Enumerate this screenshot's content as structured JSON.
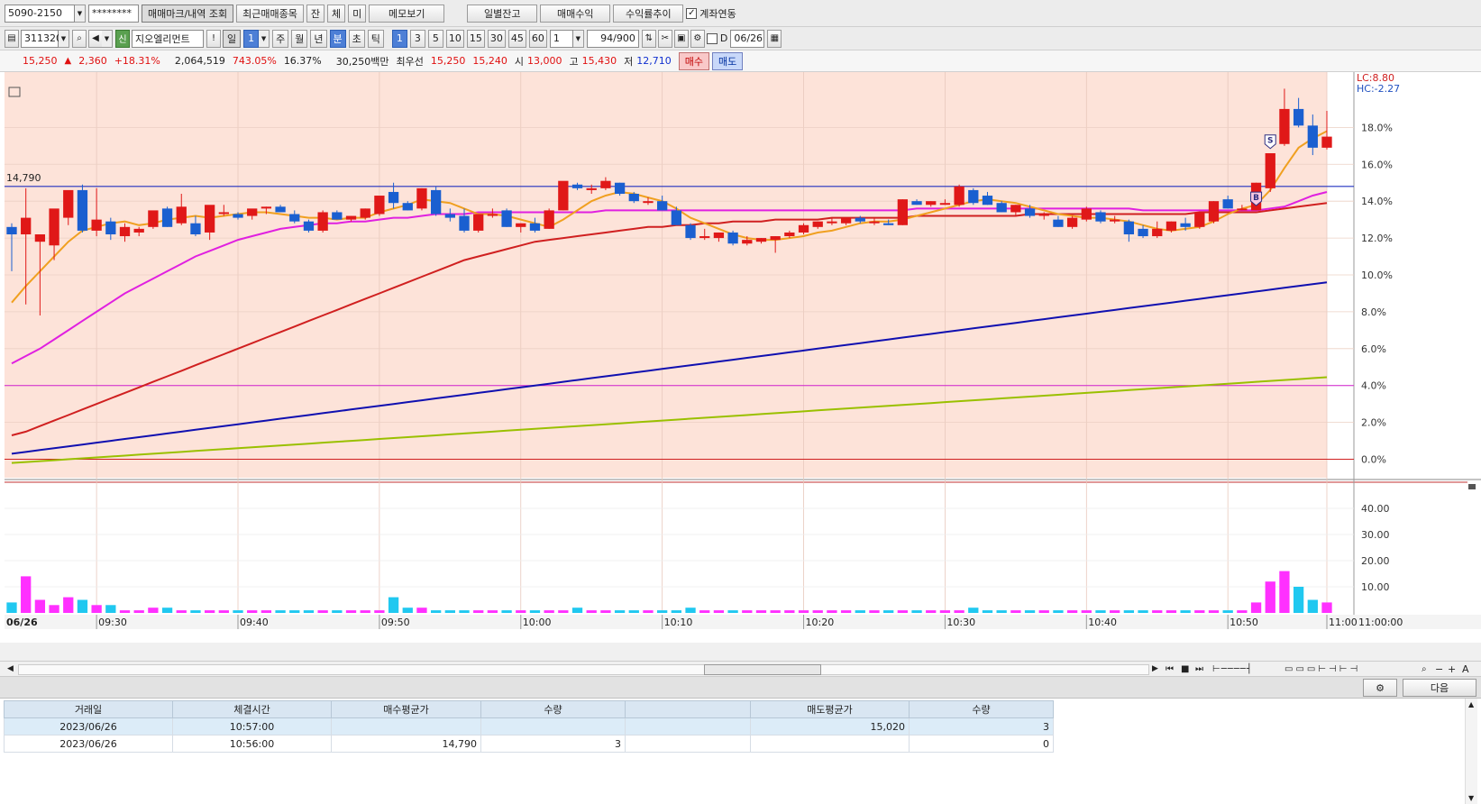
{
  "toolbar1": {
    "account": "5090-2150",
    "password": "********",
    "buttons": [
      "매매마크/내역 조회",
      "최근매매종목",
      "잔",
      "체",
      "미",
      "메모보기",
      "일별잔고",
      "매매수익",
      "수익률추이"
    ],
    "link_label": "계좌연동"
  },
  "toolbar2": {
    "code": "311320",
    "badge": "신",
    "name": "지오엘리먼트",
    "alert": "!",
    "periods": [
      "일",
      "1",
      "주",
      "월",
      "년",
      "분",
      "초",
      "틱"
    ],
    "intervals": [
      "1",
      "3",
      "5",
      "10",
      "15",
      "30",
      "45",
      "60"
    ],
    "unit_value": "1",
    "count": "94/900",
    "d_label": "D",
    "date": "06/26"
  },
  "infobar": {
    "price": "15,250",
    "change": "2,360",
    "change_pct": "+18.31%",
    "volume": "2,064,519",
    "vol_ratio": "743.05%",
    "turnover": "16.37%",
    "amount": "30,250백만",
    "quote_label": "최우선",
    "ask": "15,250",
    "bid": "15,240",
    "open_label": "시",
    "open": "13,000",
    "high_label": "고",
    "high": "15,430",
    "low_label": "저",
    "low": "12,710",
    "buy_label": "매수",
    "sell_label": "매도"
  },
  "chart": {
    "ref_line_label": "14,790",
    "lc_label": "LC:8.80",
    "hc_label": "HC:-2.27",
    "date_label": "06/26",
    "price_ticks": [
      "18.0%",
      "16.0%",
      "14.0%",
      "12.0%",
      "10.0%",
      "8.0%",
      "6.0%",
      "4.0%",
      "2.0%",
      "0.0%"
    ],
    "volume_ticks": [
      "40.00",
      "30.00",
      "20.00",
      "10.00"
    ],
    "time_ticks": [
      "09:30",
      "09:40",
      "09:50",
      "10:00",
      "10:10",
      "10:20",
      "10:30",
      "10:40",
      "10:50",
      "11:00",
      "11:00:00"
    ],
    "marker_sell": "S",
    "marker_buy": "B",
    "colors": {
      "up": "#e01818",
      "down": "#1a5fd0",
      "ma5": "#f0a020",
      "ma20": "#e020e0",
      "ma60": "#d02020",
      "ma120": "#1010b0",
      "ma240": "#9ac000"
    }
  },
  "chart_data": {
    "type": "candlestick",
    "candles": [
      {
        "o": 12.6,
        "h": 12.8,
        "l": 10.2,
        "c": 12.2
      },
      {
        "o": 12.2,
        "h": 14.7,
        "l": 8.4,
        "c": 13.1
      },
      {
        "o": 11.8,
        "h": 12.1,
        "l": 7.8,
        "c": 12.2
      },
      {
        "o": 11.6,
        "h": 12.8,
        "l": 10.8,
        "c": 13.6
      },
      {
        "o": 13.1,
        "h": 14.3,
        "l": 12.7,
        "c": 14.6
      },
      {
        "o": 14.6,
        "h": 14.9,
        "l": 12.3,
        "c": 12.4
      },
      {
        "o": 12.4,
        "h": 14.7,
        "l": 12.1,
        "c": 13.0
      },
      {
        "o": 12.9,
        "h": 13.1,
        "l": 11.9,
        "c": 12.2
      },
      {
        "o": 12.1,
        "h": 12.8,
        "l": 11.8,
        "c": 12.6
      },
      {
        "o": 12.3,
        "h": 12.6,
        "l": 12.1,
        "c": 12.5
      },
      {
        "o": 12.6,
        "h": 13.3,
        "l": 12.5,
        "c": 13.5
      },
      {
        "o": 13.6,
        "h": 13.7,
        "l": 12.6,
        "c": 12.6
      },
      {
        "o": 12.8,
        "h": 14.4,
        "l": 12.7,
        "c": 13.7
      },
      {
        "o": 12.8,
        "h": 13.2,
        "l": 12.1,
        "c": 12.2
      },
      {
        "o": 12.3,
        "h": 12.5,
        "l": 11.9,
        "c": 13.8
      },
      {
        "o": 13.4,
        "h": 13.8,
        "l": 13.2,
        "c": 13.4
      },
      {
        "o": 13.3,
        "h": 13.4,
        "l": 13.0,
        "c": 13.1
      },
      {
        "o": 13.2,
        "h": 13.4,
        "l": 13.0,
        "c": 13.6
      },
      {
        "o": 13.6,
        "h": 13.7,
        "l": 13.3,
        "c": 13.7
      },
      {
        "o": 13.7,
        "h": 13.8,
        "l": 13.4,
        "c": 13.4
      },
      {
        "o": 13.3,
        "h": 13.5,
        "l": 12.8,
        "c": 12.9
      },
      {
        "o": 12.9,
        "h": 13.0,
        "l": 12.3,
        "c": 12.4
      },
      {
        "o": 12.4,
        "h": 13.5,
        "l": 12.3,
        "c": 13.4
      },
      {
        "o": 13.4,
        "h": 13.5,
        "l": 13.0,
        "c": 13.0
      },
      {
        "o": 13.0,
        "h": 13.2,
        "l": 12.9,
        "c": 13.2
      },
      {
        "o": 13.1,
        "h": 13.6,
        "l": 13.0,
        "c": 13.6
      },
      {
        "o": 13.3,
        "h": 13.9,
        "l": 13.2,
        "c": 14.3
      },
      {
        "o": 14.5,
        "h": 15.0,
        "l": 13.6,
        "c": 13.9
      },
      {
        "o": 13.9,
        "h": 14.0,
        "l": 13.5,
        "c": 13.5
      },
      {
        "o": 13.6,
        "h": 14.7,
        "l": 13.5,
        "c": 14.7
      },
      {
        "o": 14.6,
        "h": 14.8,
        "l": 13.2,
        "c": 13.3
      },
      {
        "o": 13.3,
        "h": 13.6,
        "l": 12.9,
        "c": 13.1
      },
      {
        "o": 13.2,
        "h": 13.6,
        "l": 12.3,
        "c": 12.4
      },
      {
        "o": 12.4,
        "h": 13.2,
        "l": 12.3,
        "c": 13.3
      },
      {
        "o": 13.3,
        "h": 13.6,
        "l": 13.1,
        "c": 13.3
      },
      {
        "o": 13.5,
        "h": 13.6,
        "l": 12.6,
        "c": 12.6
      },
      {
        "o": 12.6,
        "h": 12.8,
        "l": 12.3,
        "c": 12.8
      },
      {
        "o": 12.8,
        "h": 13.1,
        "l": 12.3,
        "c": 12.4
      },
      {
        "o": 12.5,
        "h": 13.6,
        "l": 12.5,
        "c": 13.5
      },
      {
        "o": 13.5,
        "h": 14.6,
        "l": 13.5,
        "c": 15.1
      },
      {
        "o": 14.9,
        "h": 15.0,
        "l": 14.6,
        "c": 14.7
      },
      {
        "o": 14.6,
        "h": 14.9,
        "l": 14.4,
        "c": 14.7
      },
      {
        "o": 14.7,
        "h": 15.3,
        "l": 14.6,
        "c": 15.1
      },
      {
        "o": 15.0,
        "h": 15.0,
        "l": 14.3,
        "c": 14.4
      },
      {
        "o": 14.4,
        "h": 14.5,
        "l": 13.9,
        "c": 14.0
      },
      {
        "o": 14.0,
        "h": 14.2,
        "l": 13.8,
        "c": 14.0
      },
      {
        "o": 14.0,
        "h": 14.3,
        "l": 13.5,
        "c": 13.5
      },
      {
        "o": 13.5,
        "h": 13.7,
        "l": 12.7,
        "c": 12.7
      },
      {
        "o": 12.7,
        "h": 12.8,
        "l": 11.9,
        "c": 12.0
      },
      {
        "o": 12.0,
        "h": 12.5,
        "l": 11.9,
        "c": 12.1
      },
      {
        "o": 12.0,
        "h": 12.3,
        "l": 11.8,
        "c": 12.3
      },
      {
        "o": 12.3,
        "h": 12.4,
        "l": 11.6,
        "c": 11.7
      },
      {
        "o": 11.7,
        "h": 12.1,
        "l": 11.6,
        "c": 11.9
      },
      {
        "o": 11.8,
        "h": 12.0,
        "l": 11.7,
        "c": 12.0
      },
      {
        "o": 11.9,
        "h": 12.1,
        "l": 11.2,
        "c": 12.1
      },
      {
        "o": 12.1,
        "h": 12.4,
        "l": 12.0,
        "c": 12.3
      },
      {
        "o": 12.3,
        "h": 12.8,
        "l": 12.2,
        "c": 12.7
      },
      {
        "o": 12.6,
        "h": 12.9,
        "l": 12.5,
        "c": 12.9
      },
      {
        "o": 12.9,
        "h": 13.1,
        "l": 12.7,
        "c": 12.9
      },
      {
        "o": 12.8,
        "h": 13.1,
        "l": 12.7,
        "c": 13.1
      },
      {
        "o": 13.1,
        "h": 13.2,
        "l": 12.8,
        "c": 12.9
      },
      {
        "o": 12.9,
        "h": 13.1,
        "l": 12.7,
        "c": 12.9
      },
      {
        "o": 12.8,
        "h": 13.0,
        "l": 12.7,
        "c": 12.7
      },
      {
        "o": 12.7,
        "h": 14.1,
        "l": 12.7,
        "c": 14.1
      },
      {
        "o": 14.0,
        "h": 14.1,
        "l": 13.8,
        "c": 13.8
      },
      {
        "o": 13.8,
        "h": 14.0,
        "l": 13.7,
        "c": 14.0
      },
      {
        "o": 13.9,
        "h": 14.1,
        "l": 13.8,
        "c": 13.9
      },
      {
        "o": 13.8,
        "h": 14.9,
        "l": 13.7,
        "c": 14.8
      },
      {
        "o": 14.6,
        "h": 14.7,
        "l": 13.8,
        "c": 13.9
      },
      {
        "o": 14.3,
        "h": 14.5,
        "l": 13.8,
        "c": 13.8
      },
      {
        "o": 13.9,
        "h": 14.0,
        "l": 13.4,
        "c": 13.4
      },
      {
        "o": 13.4,
        "h": 13.8,
        "l": 13.2,
        "c": 13.8
      },
      {
        "o": 13.6,
        "h": 13.8,
        "l": 13.1,
        "c": 13.2
      },
      {
        "o": 13.3,
        "h": 13.4,
        "l": 13.0,
        "c": 13.3
      },
      {
        "o": 13.0,
        "h": 13.2,
        "l": 12.6,
        "c": 12.6
      },
      {
        "o": 12.6,
        "h": 13.2,
        "l": 12.5,
        "c": 13.1
      },
      {
        "o": 13.0,
        "h": 13.7,
        "l": 12.9,
        "c": 13.6
      },
      {
        "o": 13.4,
        "h": 13.5,
        "l": 12.8,
        "c": 12.9
      },
      {
        "o": 12.9,
        "h": 13.2,
        "l": 12.8,
        "c": 13.0
      },
      {
        "o": 12.9,
        "h": 13.0,
        "l": 11.8,
        "c": 12.2
      },
      {
        "o": 12.5,
        "h": 12.7,
        "l": 12.0,
        "c": 12.1
      },
      {
        "o": 12.1,
        "h": 12.9,
        "l": 12.0,
        "c": 12.5
      },
      {
        "o": 12.4,
        "h": 12.9,
        "l": 12.3,
        "c": 12.9
      },
      {
        "o": 12.8,
        "h": 13.1,
        "l": 12.4,
        "c": 12.6
      },
      {
        "o": 12.6,
        "h": 13.4,
        "l": 12.5,
        "c": 13.4
      },
      {
        "o": 12.9,
        "h": 14.0,
        "l": 12.8,
        "c": 14.0
      },
      {
        "o": 14.1,
        "h": 14.3,
        "l": 13.6,
        "c": 13.6
      },
      {
        "o": 13.6,
        "h": 13.8,
        "l": 13.5,
        "c": 13.6
      },
      {
        "o": 13.5,
        "h": 15.0,
        "l": 13.5,
        "c": 15.0
      },
      {
        "o": 14.7,
        "h": 16.6,
        "l": 14.5,
        "c": 16.6
      },
      {
        "o": 17.1,
        "h": 20.1,
        "l": 17.0,
        "c": 19.0
      },
      {
        "o": 19.0,
        "h": 19.6,
        "l": 18.0,
        "c": 18.1
      },
      {
        "o": 18.1,
        "h": 18.7,
        "l": 16.5,
        "c": 16.9
      },
      {
        "o": 16.9,
        "h": 18.9,
        "l": 16.8,
        "c": 17.5
      }
    ],
    "volume": [
      4,
      14,
      5,
      3,
      6,
      5,
      3,
      3,
      1,
      1,
      2,
      2,
      1,
      1,
      1,
      1,
      1,
      1,
      1,
      1,
      1,
      1,
      1,
      1,
      1,
      1,
      1,
      6,
      2,
      2,
      1,
      1,
      1,
      1,
      1,
      1,
      1,
      1,
      1,
      1,
      2,
      1,
      1,
      1,
      1,
      1,
      1,
      1,
      2,
      1,
      1,
      1,
      1,
      1,
      1,
      1,
      1,
      1,
      1,
      1,
      1,
      1,
      1,
      1,
      1,
      1,
      1,
      1,
      2,
      1,
      1,
      1,
      1,
      1,
      1,
      1,
      1,
      1,
      1,
      1,
      1,
      1,
      1,
      1,
      1,
      1,
      1,
      1,
      4,
      12,
      16,
      10,
      5,
      4
    ],
    "ma_lines": {
      "ma5": [
        8.5,
        9.4,
        10.2,
        11.0,
        11.8,
        12.4,
        12.6,
        12.8,
        12.9,
        12.7,
        12.8,
        13.0,
        13.1,
        13.2,
        13.1,
        13.2,
        13.3,
        13.4,
        13.4,
        13.3,
        13.2,
        13.1,
        13.1,
        13.0,
        13.1,
        13.1,
        13.4,
        13.6,
        13.8,
        14.1,
        14.0,
        13.9,
        13.6,
        13.3,
        13.3,
        13.2,
        13.0,
        12.8,
        12.6,
        13.0,
        13.5,
        14.0,
        14.3,
        14.5,
        14.4,
        14.2,
        14.0,
        13.6,
        13.1,
        12.8,
        12.5,
        12.2,
        12.0,
        11.9,
        11.9,
        12.0,
        12.1,
        12.3,
        12.4,
        12.6,
        12.8,
        12.9,
        12.9,
        13.0,
        13.2,
        13.4,
        13.6,
        13.8,
        14.0,
        14.1,
        14.0,
        13.9,
        13.7,
        13.5,
        13.3,
        13.2,
        13.1,
        13.1,
        13.0,
        12.9,
        12.7,
        12.5,
        12.4,
        12.5,
        12.6,
        12.9,
        13.3,
        13.6,
        13.8,
        14.6,
        15.8,
        16.9,
        17.4,
        17.8
      ],
      "ma20": [
        5.2,
        5.6,
        6.0,
        6.5,
        7.0,
        7.5,
        8.0,
        8.5,
        9.0,
        9.4,
        9.8,
        10.2,
        10.6,
        11.0,
        11.3,
        11.6,
        11.9,
        12.1,
        12.3,
        12.5,
        12.6,
        12.7,
        12.8,
        12.8,
        12.9,
        12.9,
        13.0,
        13.1,
        13.1,
        13.2,
        13.3,
        13.3,
        13.3,
        13.4,
        13.4,
        13.4,
        13.4,
        13.4,
        13.4,
        13.4,
        13.4,
        13.4,
        13.5,
        13.5,
        13.5,
        13.5,
        13.5,
        13.5,
        13.5,
        13.5,
        13.5,
        13.5,
        13.5,
        13.5,
        13.5,
        13.5,
        13.5,
        13.5,
        13.5,
        13.5,
        13.5,
        13.5,
        13.5,
        13.5,
        13.6,
        13.6,
        13.6,
        13.6,
        13.6,
        13.6,
        13.6,
        13.6,
        13.6,
        13.6,
        13.6,
        13.6,
        13.6,
        13.6,
        13.6,
        13.6,
        13.5,
        13.5,
        13.5,
        13.5,
        13.5,
        13.5,
        13.5,
        13.5,
        13.5,
        13.6,
        13.7,
        14.0,
        14.3,
        14.5
      ],
      "ma60": [
        1.3,
        1.5,
        1.8,
        2.1,
        2.4,
        2.7,
        3.0,
        3.3,
        3.6,
        3.9,
        4.2,
        4.5,
        4.8,
        5.1,
        5.4,
        5.7,
        6.0,
        6.3,
        6.6,
        6.9,
        7.2,
        7.5,
        7.8,
        8.1,
        8.4,
        8.7,
        9.0,
        9.3,
        9.6,
        9.9,
        10.2,
        10.5,
        10.8,
        11.0,
        11.2,
        11.4,
        11.6,
        11.8,
        11.9,
        12.0,
        12.1,
        12.2,
        12.3,
        12.4,
        12.5,
        12.6,
        12.6,
        12.7,
        12.7,
        12.8,
        12.8,
        12.9,
        12.9,
        12.9,
        13.0,
        13.0,
        13.0,
        13.0,
        13.1,
        13.1,
        13.1,
        13.1,
        13.1,
        13.1,
        13.2,
        13.2,
        13.2,
        13.2,
        13.2,
        13.2,
        13.2,
        13.2,
        13.3,
        13.3,
        13.3,
        13.3,
        13.3,
        13.3,
        13.3,
        13.3,
        13.3,
        13.3,
        13.3,
        13.3,
        13.4,
        13.4,
        13.4,
        13.4,
        13.4,
        13.5,
        13.6,
        13.7,
        13.8,
        13.9
      ],
      "ma120": [
        0.3,
        0.4,
        0.5,
        0.6,
        0.7,
        0.8,
        0.9,
        1.0,
        1.1,
        1.2,
        1.3,
        1.4,
        1.5,
        1.6,
        1.7,
        1.8,
        1.9,
        2.0,
        2.1,
        2.2,
        2.3,
        2.4,
        2.5,
        2.6,
        2.7,
        2.8,
        2.9,
        3.0,
        3.1,
        3.2,
        3.3,
        3.4,
        3.5,
        3.6,
        3.7,
        3.8,
        3.9,
        4.0,
        4.1,
        4.2,
        4.3,
        4.4,
        4.5,
        4.6,
        4.7,
        4.8,
        4.9,
        5.0,
        5.1,
        5.2,
        5.3,
        5.4,
        5.5,
        5.6,
        5.7,
        5.8,
        5.9,
        6.0,
        6.1,
        6.2,
        6.3,
        6.4,
        6.5,
        6.6,
        6.7,
        6.8,
        6.9,
        7.0,
        7.1,
        7.2,
        7.3,
        7.4,
        7.5,
        7.6,
        7.7,
        7.8,
        7.9,
        8.0,
        8.1,
        8.2,
        8.3,
        8.4,
        8.5,
        8.6,
        8.7,
        8.8,
        8.9,
        9.0,
        9.1,
        9.2,
        9.3,
        9.4,
        9.5,
        9.6
      ],
      "ma240": [
        -0.2,
        -0.15,
        -0.1,
        -0.05,
        0,
        0.05,
        0.1,
        0.15,
        0.2,
        0.25,
        0.3,
        0.35,
        0.4,
        0.45,
        0.5,
        0.55,
        0.6,
        0.65,
        0.7,
        0.75,
        0.8,
        0.85,
        0.9,
        0.95,
        1.0,
        1.05,
        1.1,
        1.15,
        1.2,
        1.25,
        1.3,
        1.35,
        1.4,
        1.45,
        1.5,
        1.55,
        1.6,
        1.65,
        1.7,
        1.75,
        1.8,
        1.85,
        1.9,
        1.95,
        2.0,
        2.05,
        2.1,
        2.15,
        2.2,
        2.25,
        2.3,
        2.35,
        2.4,
        2.45,
        2.5,
        2.55,
        2.6,
        2.65,
        2.7,
        2.75,
        2.8,
        2.85,
        2.9,
        2.95,
        3.0,
        3.05,
        3.1,
        3.15,
        3.2,
        3.25,
        3.3,
        3.35,
        3.4,
        3.45,
        3.5,
        3.55,
        3.6,
        3.65,
        3.7,
        3.75,
        3.8,
        3.85,
        3.9,
        3.95,
        4.0,
        4.05,
        4.1,
        4.15,
        4.2,
        4.25,
        4.3,
        4.35,
        4.4,
        4.45
      ]
    },
    "ylim": [
      -1.0,
      21.0
    ],
    "volume_ylim": [
      0,
      50
    ],
    "grid": true
  },
  "scroll": {
    "next_label": "다음"
  },
  "trades": {
    "headers": [
      "거래일",
      "체결시간",
      "매수평균가",
      "수량",
      "",
      "매도평균가",
      "수량"
    ],
    "rows": [
      [
        "2023/06/26",
        "10:57:00",
        "",
        "",
        "",
        "15,020",
        "3"
      ],
      [
        "2023/06/26",
        "10:56:00",
        "14,790",
        "3",
        "",
        "",
        "0"
      ]
    ]
  }
}
